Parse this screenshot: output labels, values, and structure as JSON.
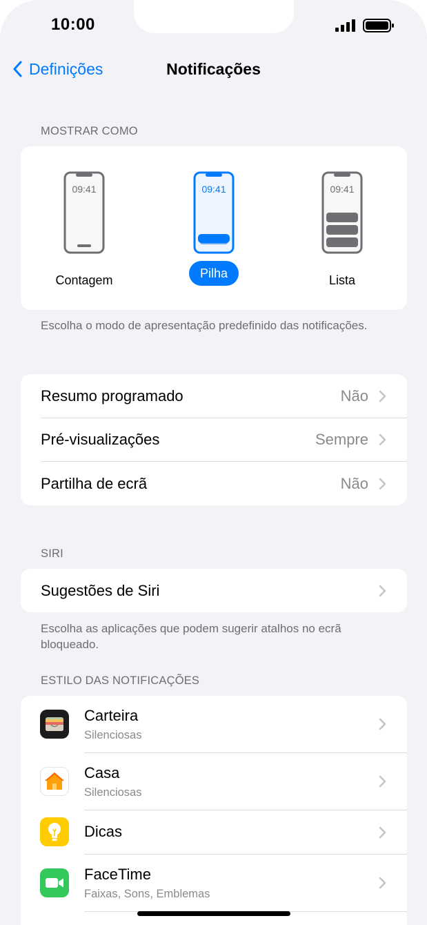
{
  "status_bar": {
    "time": "10:00"
  },
  "nav": {
    "back_label": "Definições",
    "title": "Notificações"
  },
  "display_as": {
    "header": "MOSTRAR COMO",
    "options": [
      {
        "label": "Contagem",
        "clock": "09:41",
        "selected": false
      },
      {
        "label": "Pilha",
        "clock": "09:41",
        "selected": true
      },
      {
        "label": "Lista",
        "clock": "09:41",
        "selected": false
      }
    ],
    "footer": "Escolha o modo de apresentação predefinido das notificações."
  },
  "settings": {
    "rows": [
      {
        "label": "Resumo programado",
        "value": "Não"
      },
      {
        "label": "Pré-visualizações",
        "value": "Sempre"
      },
      {
        "label": "Partilha de ecrã",
        "value": "Não"
      }
    ]
  },
  "siri": {
    "header": "SIRI",
    "row_label": "Sugestões de Siri",
    "footer": "Escolha as aplicações que podem sugerir atalhos no ecrã bloqueado."
  },
  "notification_style": {
    "header": "ESTILO DAS NOTIFICAÇÕES",
    "apps": [
      {
        "name": "Carteira",
        "subtitle": "Silenciosas",
        "icon": "wallet-icon"
      },
      {
        "name": "Casa",
        "subtitle": "Silenciosas",
        "icon": "home-icon"
      },
      {
        "name": "Dicas",
        "subtitle": "",
        "icon": "tips-icon"
      },
      {
        "name": "FaceTime",
        "subtitle": "Faixas, Sons, Emblemas",
        "icon": "facetime-icon"
      }
    ]
  },
  "colors": {
    "accent": "#007aff",
    "background": "#f2f2f7",
    "secondary_text": "#8a8a8e"
  }
}
